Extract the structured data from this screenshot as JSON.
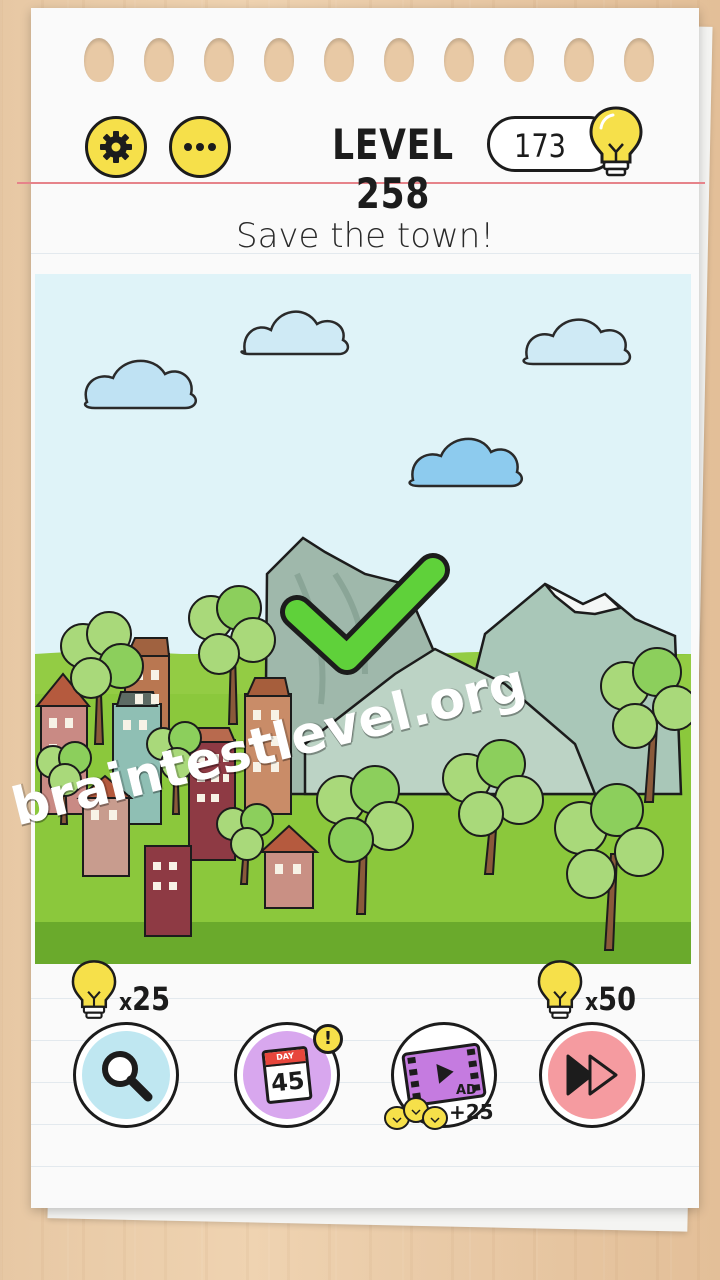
{
  "header": {
    "level_label": "LEVEL 258",
    "hint_count": "173"
  },
  "instruction": "Save the town!",
  "watermark": "braintestlevel.org",
  "tools": {
    "hint_cost": "25",
    "skip_cost": "50",
    "daily_day_label": "DAY",
    "daily_day_number": "45",
    "daily_alert": "!",
    "ad_label": "AD",
    "ad_reward": "+25",
    "cost_prefix": "x"
  },
  "colors": {
    "accent_yellow": "#f6e04a",
    "sky": "#dff3f8",
    "grass": "#8bc83c",
    "check": "#5fd13a",
    "magnifier_bg": "#bfe7f1",
    "daily_bg": "#d8a7ee",
    "ad_bg": "#c57be0",
    "skip_bg": "#f59ba0"
  },
  "icons": [
    "gear-icon",
    "more-icon",
    "lightbulb-icon",
    "magnifier-icon",
    "calendar-icon",
    "video-ad-icon",
    "skip-icon",
    "checkmark-icon"
  ]
}
